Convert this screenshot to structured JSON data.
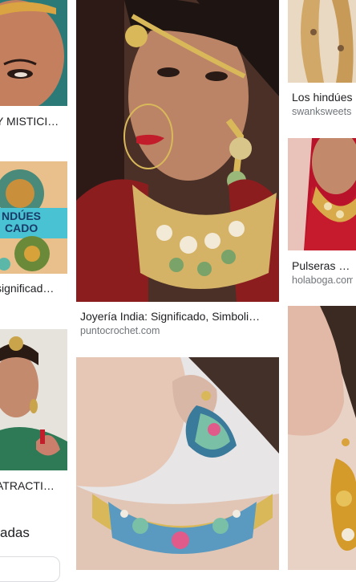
{
  "results": {
    "col1": [
      {
        "title": "Y MISTICI…",
        "source": ""
      },
      {
        "title": "significad…",
        "source": "",
        "thumb_text_line1": "NDÚES",
        "thumb_text_line2": "CADO"
      },
      {
        "title": "ATRACTI…",
        "source": ""
      }
    ],
    "col2": [
      {
        "title": "Joyería India: Significado, Simboli…",
        "source": "puntocrochet.com"
      },
      {
        "title": "",
        "source": ""
      }
    ],
    "col3": [
      {
        "title": "Los hindúes",
        "source": "swanksweets"
      },
      {
        "title": "Pulseras Hin",
        "source": "holaboga.com"
      },
      {
        "title": "",
        "source": ""
      }
    ]
  },
  "related": {
    "heading": "adas"
  },
  "colors": {
    "title_text": "#202124",
    "source_text": "#70757a",
    "teal_banner": "#49c3d3"
  },
  "icons": [
    "image-thumbnail"
  ]
}
